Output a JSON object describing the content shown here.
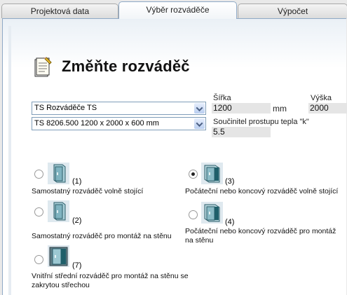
{
  "tabs": [
    {
      "label": "Projektová data",
      "active": false
    },
    {
      "label": "Výběr rozváděče",
      "active": true
    },
    {
      "label": "Výpočet",
      "active": false
    }
  ],
  "header": {
    "title": "Změňte rozváděč",
    "icon": "notepad-icon"
  },
  "selects": {
    "series": "TS Rozváděče TS",
    "model": "TS 8206.500  1200 x 2000 x 600 mm"
  },
  "dimensions": {
    "width_label": "Šířka",
    "width_value": "1200",
    "width_unit": "mm",
    "height_label": "Výška",
    "height_value": "2000",
    "k_label": "Součinitel prostupu tepla \"k\"",
    "k_value": "5.5"
  },
  "options": [
    {
      "num": "(1)",
      "label": "Samostatný rozváděč volně stojící",
      "checked": false
    },
    {
      "num": "(2)",
      "label": "Samostatný rozváděč pro montáž na stěnu",
      "checked": false
    },
    {
      "num": "(3)",
      "label": "Počáteční nebo koncový rozváděč volně stojící",
      "checked": true
    },
    {
      "num": "(4)",
      "label": "Počáteční nebo koncový rozváděč pro montáž na stěnu",
      "checked": false
    },
    {
      "num": "(7)",
      "label": "Vnitřní střední rozváděč pro montáž na stěnu se zakrytou střechou",
      "checked": false
    }
  ],
  "colors": {
    "accent": "#8fa9c6",
    "cabinet_fill": "#8fb9c6",
    "cabinet_dark": "#1f5f6a"
  }
}
